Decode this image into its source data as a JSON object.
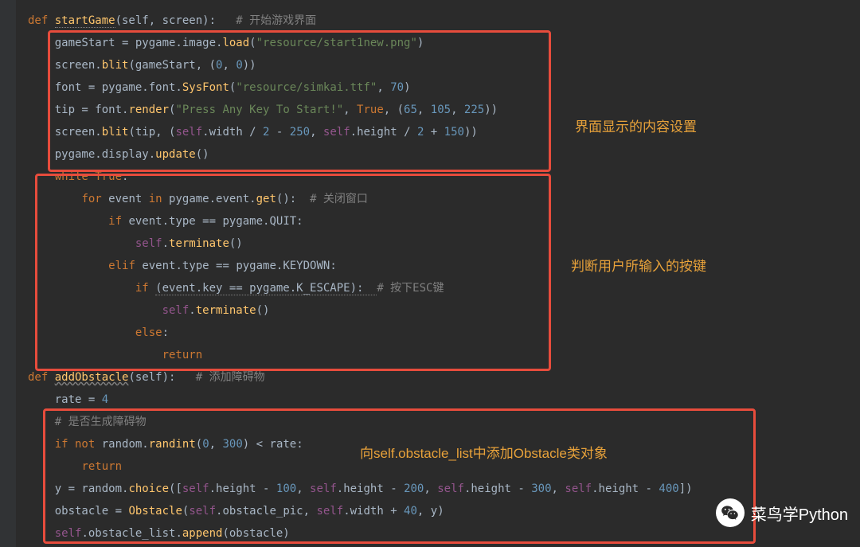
{
  "code": {
    "l1_def": "def ",
    "l1_fn": "startGame",
    "l1_params": "(self, screen):   ",
    "l1_comment": "# 开始游戏界面",
    "l2_a": "    gameStart = pygame.image.",
    "l2_fn": "load",
    "l2_b": "(",
    "l2_str": "\"resource/start1new.png\"",
    "l2_c": ")",
    "l3_a": "    screen.",
    "l3_fn": "blit",
    "l3_b": "(gameStart, (",
    "l3_n1": "0",
    "l3_c": ", ",
    "l3_n2": "0",
    "l3_d": "))",
    "l4_a": "    font = pygame.font.",
    "l4_fn": "SysFont",
    "l4_b": "(",
    "l4_str": "\"resource/simkai.ttf\"",
    "l4_c": ", ",
    "l4_n": "70",
    "l4_d": ")",
    "l5_a": "    tip = font.",
    "l5_fn": "render",
    "l5_b": "(",
    "l5_str": "\"Press Any Key To Start!\"",
    "l5_c": ", ",
    "l5_true": "True",
    "l5_d": ", (",
    "l5_n1": "65",
    "l5_e": ", ",
    "l5_n2": "105",
    "l5_f": ", ",
    "l5_n3": "225",
    "l5_g": "))",
    "l6_a": "    screen.",
    "l6_fn": "blit",
    "l6_b": "(tip, (",
    "l6_self1": "self",
    "l6_c": ".width / ",
    "l6_n1": "2",
    "l6_d": " - ",
    "l6_n2": "250",
    "l6_e": ", ",
    "l6_self2": "self",
    "l6_f": ".height / ",
    "l6_n3": "2",
    "l6_g": " + ",
    "l6_n4": "150",
    "l6_h": "))",
    "l7_a": "    pygame.display.",
    "l7_fn": "update",
    "l7_b": "()",
    "l8_a": "    ",
    "l8_while": "while ",
    "l8_true": "True",
    "l8_b": ":",
    "l9_a": "        ",
    "l9_for": "for ",
    "l9_b": "event ",
    "l9_in": "in ",
    "l9_c": "pygame.event.",
    "l9_fn": "get",
    "l9_d": "():  ",
    "l9_comment": "# 关闭窗口",
    "l10_a": "            ",
    "l10_if": "if ",
    "l10_b": "event.type == pygame.QUIT:",
    "l11_a": "                ",
    "l11_self": "self",
    "l11_b": ".",
    "l11_fn": "terminate",
    "l11_c": "()",
    "l12_a": "            ",
    "l12_elif": "elif ",
    "l12_b": "event.type == pygame.KEYDOWN:",
    "l13_a": "                ",
    "l13_if": "if ",
    "l13_b": "(event.key == pygame.K_ESCAPE):  ",
    "l13_comment": "# 按下ESC键",
    "l14_a": "                    ",
    "l14_self": "self",
    "l14_b": ".",
    "l14_fn": "terminate",
    "l14_c": "()",
    "l15_a": "                ",
    "l15_else": "else",
    "l15_b": ":",
    "l16_a": "                    ",
    "l16_return": "return",
    "l17_def": "def ",
    "l17_fn": "addObstacle",
    "l17_params": "(self):   ",
    "l17_comment": "# 添加障碍物",
    "l18_a": "    rate = ",
    "l18_n": "4",
    "l19_a": "    ",
    "l19_comment": "# 是否生成障碍物",
    "l20_a": "    ",
    "l20_if": "if not ",
    "l20_b": "random.",
    "l20_fn": "randint",
    "l20_c": "(",
    "l20_n1": "0",
    "l20_d": ", ",
    "l20_n2": "300",
    "l20_e": ") < rate:",
    "l21_a": "        ",
    "l21_return": "return",
    "l22_a": "    y = random.",
    "l22_fn": "choice",
    "l22_b": "([",
    "l22_self1": "self",
    "l22_c": ".height - ",
    "l22_n1": "100",
    "l22_d": ", ",
    "l22_self2": "self",
    "l22_e": ".height - ",
    "l22_n2": "200",
    "l22_f": ", ",
    "l22_self3": "self",
    "l22_g": ".height - ",
    "l22_n3": "300",
    "l22_h": ", ",
    "l22_self4": "self",
    "l22_i": ".height - ",
    "l22_n4": "400",
    "l22_j": "])",
    "l23_a": "    obstacle = ",
    "l23_fn": "Obstacle",
    "l23_b": "(",
    "l23_self1": "self",
    "l23_c": ".obstacle_pic, ",
    "l23_self2": "self",
    "l23_d": ".width + ",
    "l23_n": "40",
    "l23_e": ", y)",
    "l24_a": "    ",
    "l24_self": "self",
    "l24_b": ".obstacle_list.",
    "l24_fn": "append",
    "l24_c": "(obstacle)"
  },
  "annotations": {
    "a1": "界面显示的内容设置",
    "a2": "判断用户所输入的按键",
    "a3": "向self.obstacle_list中添加Obstacle类对象"
  },
  "watermark": "菜鸟学Python"
}
